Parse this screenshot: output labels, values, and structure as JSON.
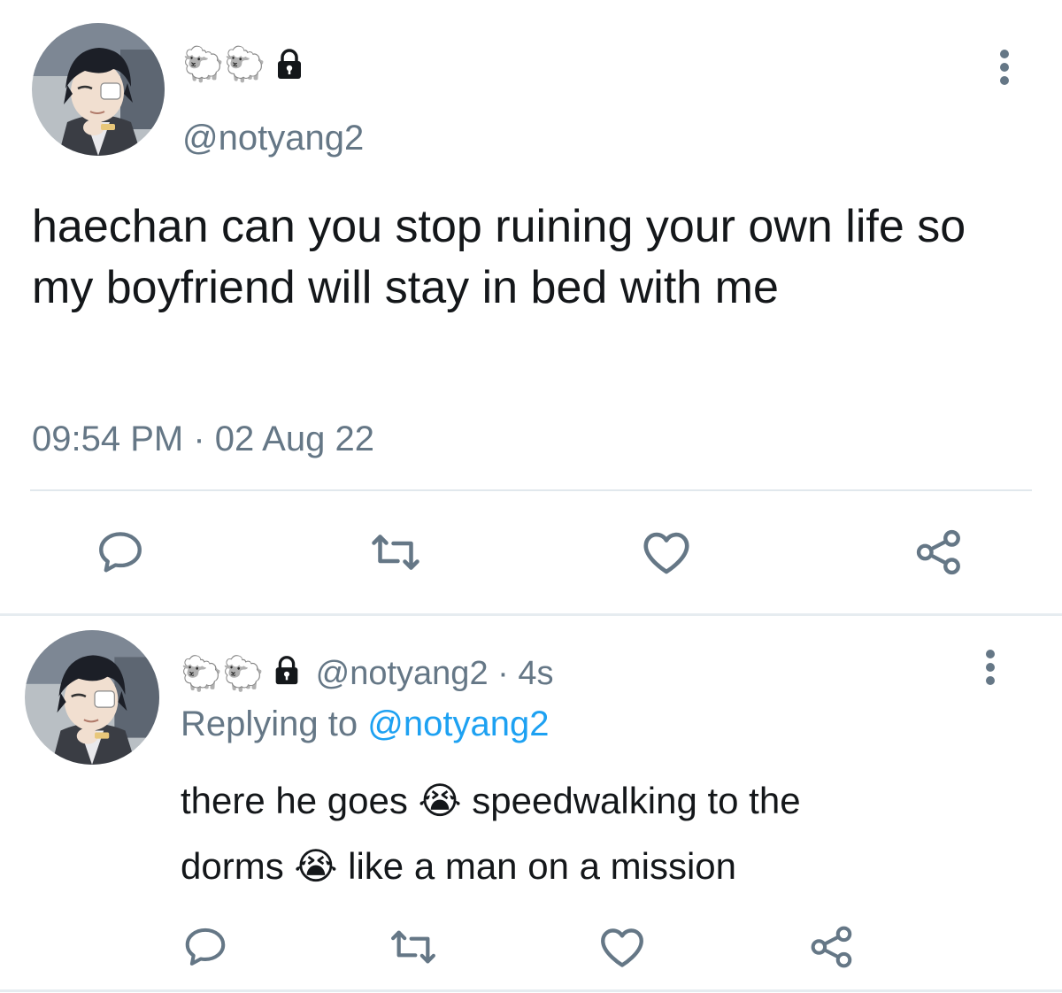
{
  "main_tweet": {
    "display_name": "🐑🐑",
    "handle": "@notyang2",
    "text": "haechan can you stop ruining your own life so my boyfriend will stay in bed with me",
    "timestamp": "09:54 PM · 02 Aug 22",
    "actions": [
      "reply-icon",
      "retweet-icon",
      "like-icon",
      "share-icon"
    ]
  },
  "reply_tweet": {
    "display_name": "🐑🐑",
    "handle_time": "@notyang2 · 4s",
    "replying_prefix": "Replying to",
    "replying_handle": "@notyang2",
    "text_line1_a": "there he goes",
    "emoji": "😭",
    "text_line1_b": "speedwalking to the",
    "text_line2_a": "dorms",
    "text_line2_b": "like a man on a mission",
    "actions": [
      "reply-icon",
      "retweet-icon",
      "like-icon",
      "share-icon"
    ]
  },
  "colors": {
    "text": "#14171a",
    "secondary": "#657786",
    "link": "#1da1f2",
    "divider": "#e1e8ed"
  }
}
